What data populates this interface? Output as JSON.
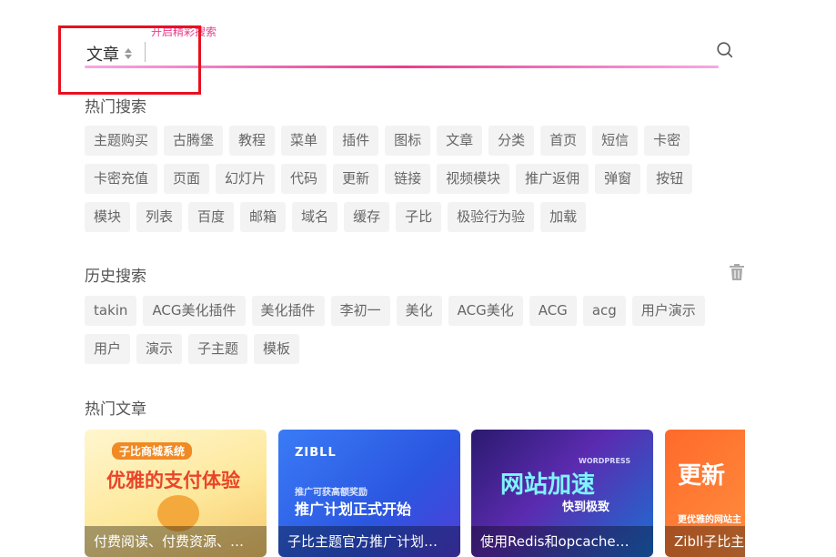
{
  "search": {
    "hint": "开启精彩搜索",
    "type_selected": "文章",
    "input_value": "",
    "placeholder": ""
  },
  "hot_search": {
    "title": "热门搜索",
    "rows": [
      [
        "主题购买",
        "古腾堡",
        "教程",
        "菜单",
        "插件",
        "图标",
        "文章",
        "分类",
        "首页",
        "短信",
        "卡密"
      ],
      [
        "卡密充值",
        "页面",
        "幻灯片",
        "代码",
        "更新",
        "链接",
        "视频模块",
        "推广返佣",
        "弹窗",
        "按钮"
      ],
      [
        "模块",
        "列表",
        "百度",
        "邮箱",
        "域名",
        "缓存",
        "子比",
        "极验行为验",
        "加载"
      ]
    ]
  },
  "history_search": {
    "title": "历史搜索",
    "rows": [
      [
        "takin",
        "ACG美化插件",
        "美化插件",
        "李初一",
        "美化",
        "ACG美化",
        "ACG",
        "acg",
        "用户演示"
      ],
      [
        "用户",
        "演示",
        "子主题",
        "模板"
      ]
    ]
  },
  "hot_articles": {
    "title": "热门文章",
    "cards": [
      {
        "title": "付费阅读、付费资源、…",
        "art_top": "子比商城系统",
        "art_main": "优雅的支付体验"
      },
      {
        "title": "子比主题官方推广计划…",
        "art_top": "ZIBLL",
        "art_sub": "推广可获高额奖励",
        "art_main": "推广计划正式开始"
      },
      {
        "title": "使用Redis和opcache…",
        "art_top": "WORDPRESS",
        "art_main": "网站加速",
        "art_sub": "快到极致"
      },
      {
        "title": "Zibll子比主",
        "art_main": "更新",
        "art_sub": "更优雅的网站主"
      }
    ]
  },
  "colors": {
    "accent": "#e83e8c",
    "highlight_box": "#e8101f"
  }
}
